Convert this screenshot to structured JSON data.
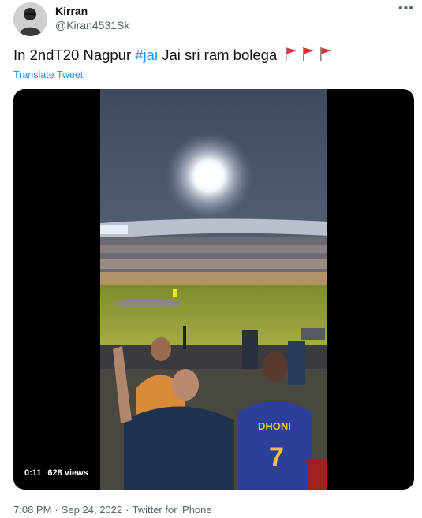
{
  "author": {
    "name": "Kirran",
    "handle": "@Kiran4531Sk"
  },
  "tweet": {
    "text_before": "In 2ndT20 Nagpur ",
    "hashtag": "#jai",
    "text_after": " Jai sri ram bolega",
    "flag_icons": [
      "triangular-flag-icon",
      "triangular-flag-icon",
      "triangular-flag-icon"
    ],
    "translate_label": "Translate Tweet"
  },
  "video": {
    "duration": "0:11",
    "views": "628 views"
  },
  "meta": {
    "time": "7:08 PM",
    "separator": "·",
    "date": "Sep 24, 2022",
    "source": "Twitter for iPhone"
  },
  "colors": {
    "link": "#1d9bf0",
    "secondary_text": "#536471",
    "flag": "#e0313b"
  }
}
